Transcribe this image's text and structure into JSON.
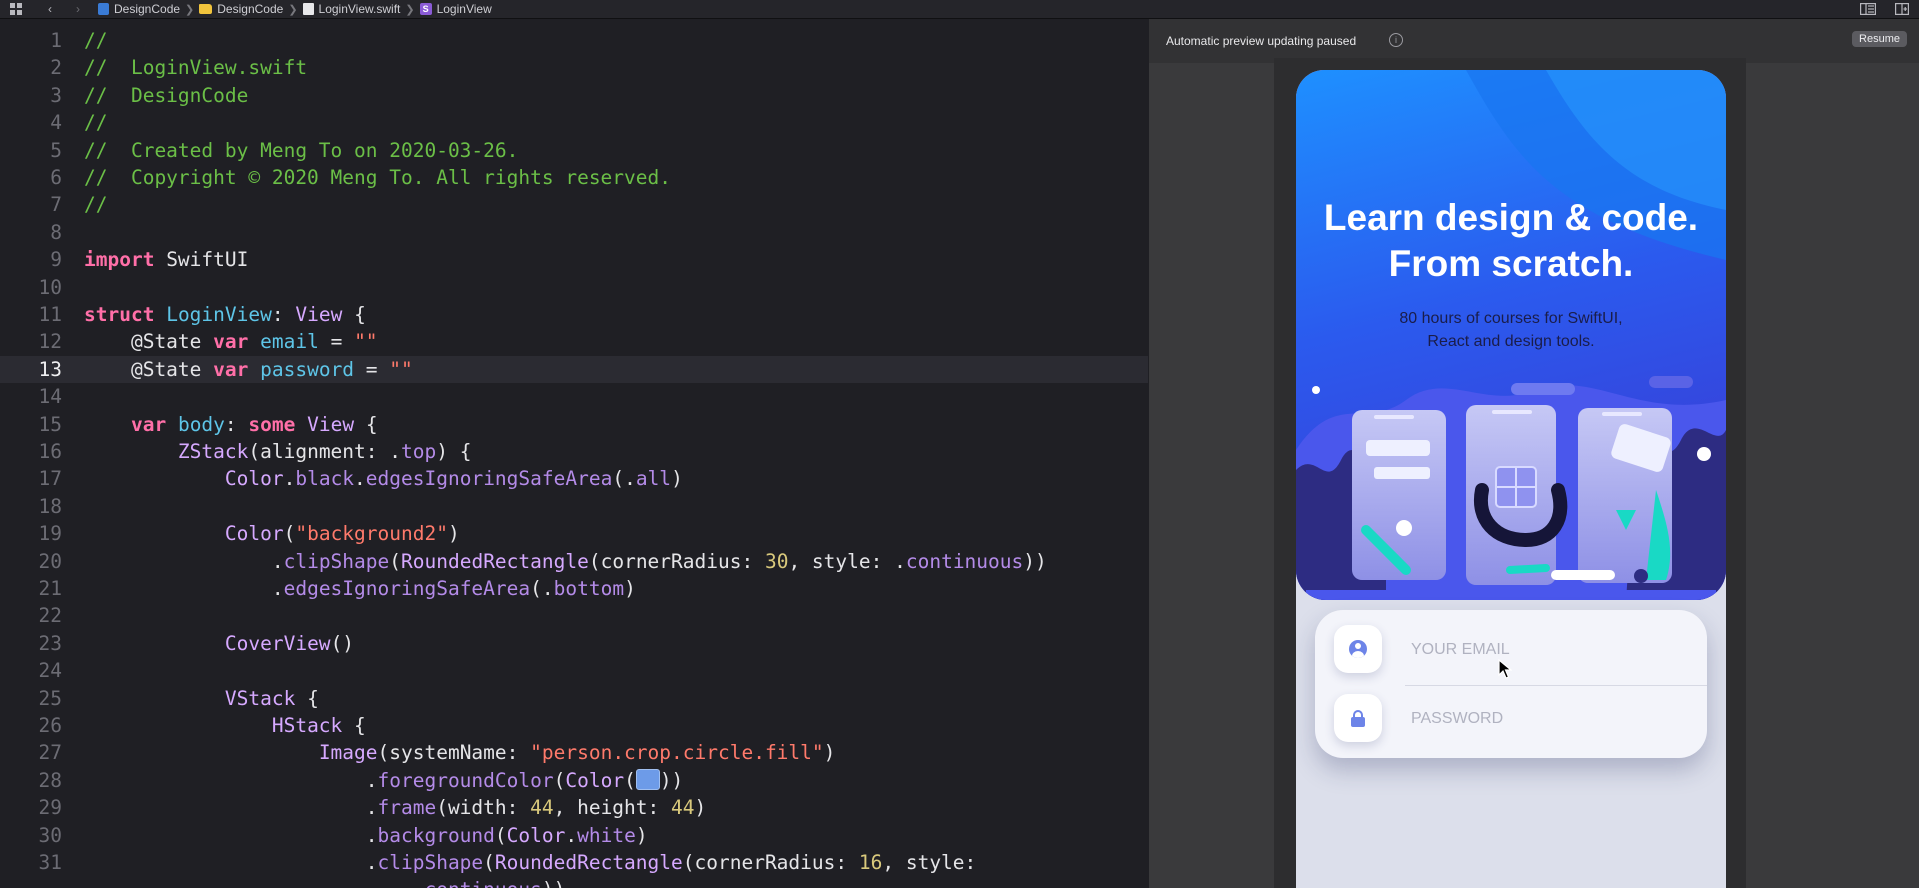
{
  "breadcrumb": {
    "items": [
      "DesignCode",
      "DesignCode",
      "LoginView.swift",
      "LoginView"
    ]
  },
  "editor": {
    "active_line": 13,
    "lines": [
      {
        "n": "1",
        "tokens": [
          [
            "c",
            "//"
          ]
        ]
      },
      {
        "n": "2",
        "tokens": [
          [
            "c",
            "//  LoginView.swift"
          ]
        ]
      },
      {
        "n": "3",
        "tokens": [
          [
            "c",
            "//  DesignCode"
          ]
        ]
      },
      {
        "n": "4",
        "tokens": [
          [
            "c",
            "//"
          ]
        ]
      },
      {
        "n": "5",
        "tokens": [
          [
            "c",
            "//  Created by Meng To on 2020-03-26."
          ]
        ]
      },
      {
        "n": "6",
        "tokens": [
          [
            "c",
            "//  Copyright © 2020 Meng To. All rights reserved."
          ]
        ]
      },
      {
        "n": "7",
        "tokens": [
          [
            "c",
            "//"
          ]
        ]
      },
      {
        "n": "8",
        "tokens": []
      },
      {
        "n": "9",
        "tokens": [
          [
            "k",
            "import"
          ],
          [
            "p",
            " SwiftUI"
          ]
        ]
      },
      {
        "n": "10",
        "tokens": []
      },
      {
        "n": "11",
        "tokens": [
          [
            "k",
            "struct"
          ],
          [
            "p",
            " "
          ],
          [
            "tn",
            "LoginView"
          ],
          [
            "p",
            ": "
          ],
          [
            "t",
            "View"
          ],
          [
            "p",
            " {"
          ]
        ]
      },
      {
        "n": "12",
        "tokens": [
          [
            "p",
            "    @State "
          ],
          [
            "k",
            "var"
          ],
          [
            "p",
            " "
          ],
          [
            "tn",
            "email"
          ],
          [
            "p",
            " = "
          ],
          [
            "s",
            "\"\""
          ]
        ]
      },
      {
        "n": "13",
        "tokens": [
          [
            "p",
            "    @State "
          ],
          [
            "k",
            "var"
          ],
          [
            "p",
            " "
          ],
          [
            "tn",
            "password"
          ],
          [
            "p",
            " = "
          ],
          [
            "s",
            "\"\""
          ]
        ]
      },
      {
        "n": "14",
        "tokens": []
      },
      {
        "n": "15",
        "tokens": [
          [
            "p",
            "    "
          ],
          [
            "k",
            "var"
          ],
          [
            "p",
            " "
          ],
          [
            "tn",
            "body"
          ],
          [
            "p",
            ": "
          ],
          [
            "k",
            "some"
          ],
          [
            "p",
            " "
          ],
          [
            "t",
            "View"
          ],
          [
            "p",
            " {"
          ]
        ]
      },
      {
        "n": "16",
        "tokens": [
          [
            "p",
            "        "
          ],
          [
            "t",
            "ZStack"
          ],
          [
            "p",
            "(alignment: ."
          ],
          [
            "m",
            "top"
          ],
          [
            "p",
            ") {"
          ]
        ]
      },
      {
        "n": "17",
        "tokens": [
          [
            "p",
            "            "
          ],
          [
            "t",
            "Color"
          ],
          [
            "p",
            "."
          ],
          [
            "m",
            "black"
          ],
          [
            "p",
            "."
          ],
          [
            "m",
            "edgesIgnoringSafeArea"
          ],
          [
            "p",
            "(."
          ],
          [
            "m",
            "all"
          ],
          [
            "p",
            ")"
          ]
        ]
      },
      {
        "n": "18",
        "tokens": []
      },
      {
        "n": "19",
        "tokens": [
          [
            "p",
            "            "
          ],
          [
            "t",
            "Color"
          ],
          [
            "p",
            "("
          ],
          [
            "s",
            "\"background2\""
          ],
          [
            "p",
            ")"
          ]
        ]
      },
      {
        "n": "20",
        "tokens": [
          [
            "p",
            "                ."
          ],
          [
            "m",
            "clipShape"
          ],
          [
            "p",
            "("
          ],
          [
            "t",
            "RoundedRectangle"
          ],
          [
            "p",
            "(cornerRadius: "
          ],
          [
            "n",
            "30"
          ],
          [
            "p",
            ", style: ."
          ],
          [
            "m",
            "continuous"
          ],
          [
            "p",
            "))"
          ]
        ]
      },
      {
        "n": "21",
        "tokens": [
          [
            "p",
            "                ."
          ],
          [
            "m",
            "edgesIgnoringSafeArea"
          ],
          [
            "p",
            "(."
          ],
          [
            "m",
            "bottom"
          ],
          [
            "p",
            ")"
          ]
        ]
      },
      {
        "n": "22",
        "tokens": []
      },
      {
        "n": "23",
        "tokens": [
          [
            "p",
            "            "
          ],
          [
            "t",
            "CoverView"
          ],
          [
            "p",
            "()"
          ]
        ]
      },
      {
        "n": "24",
        "tokens": []
      },
      {
        "n": "25",
        "tokens": [
          [
            "p",
            "            "
          ],
          [
            "t",
            "VStack"
          ],
          [
            "p",
            " {"
          ]
        ]
      },
      {
        "n": "26",
        "tokens": [
          [
            "p",
            "                "
          ],
          [
            "t",
            "HStack"
          ],
          [
            "p",
            " {"
          ]
        ]
      },
      {
        "n": "27",
        "tokens": [
          [
            "p",
            "                    "
          ],
          [
            "t",
            "Image"
          ],
          [
            "p",
            "(systemName: "
          ],
          [
            "s",
            "\"person.crop.circle.fill\""
          ],
          [
            "p",
            ")"
          ]
        ]
      },
      {
        "n": "28",
        "tokens": [
          [
            "p",
            "                        ."
          ],
          [
            "m",
            "foregroundColor"
          ],
          [
            "p",
            "("
          ],
          [
            "t",
            "Color"
          ],
          [
            "p",
            "("
          ],
          [
            "sw",
            ""
          ],
          [
            "p",
            "))"
          ]
        ]
      },
      {
        "n": "29",
        "tokens": [
          [
            "p",
            "                        ."
          ],
          [
            "m",
            "frame"
          ],
          [
            "p",
            "(width: "
          ],
          [
            "n",
            "44"
          ],
          [
            "p",
            ", height: "
          ],
          [
            "n",
            "44"
          ],
          [
            "p",
            ")"
          ]
        ]
      },
      {
        "n": "30",
        "tokens": [
          [
            "p",
            "                        ."
          ],
          [
            "m",
            "background"
          ],
          [
            "p",
            "("
          ],
          [
            "t",
            "Color"
          ],
          [
            "p",
            "."
          ],
          [
            "m",
            "white"
          ],
          [
            "p",
            ")"
          ]
        ]
      },
      {
        "n": "31",
        "tokens": [
          [
            "p",
            "                        ."
          ],
          [
            "m",
            "clipShape"
          ],
          [
            "p",
            "("
          ],
          [
            "t",
            "RoundedRectangle"
          ],
          [
            "p",
            "(cornerRadius: "
          ],
          [
            "n",
            "16"
          ],
          [
            "p",
            ", style:"
          ]
        ]
      },
      {
        "n": "",
        "tokens": [
          [
            "p",
            "                            ."
          ],
          [
            "m",
            "continuous"
          ],
          [
            "p",
            "))"
          ]
        ]
      }
    ]
  },
  "preview": {
    "status_text": "Automatic preview updating paused",
    "resume_label": "Resume",
    "hero_title_line1": "Learn design & code.",
    "hero_title_line2": "From scratch.",
    "hero_sub_line1": "80 hours of courses for SwiftUI,",
    "hero_sub_line2": "React and design tools.",
    "email_placeholder": "YOUR EMAIL",
    "password_placeholder": "PASSWORD"
  },
  "colors": {
    "hero_blue": "#2b4ae8",
    "accent": "#6d84e8",
    "comment": "#6bbf47",
    "keyword": "#ff6fa8"
  },
  "icons": {
    "top_left": "grid-icon",
    "back": "chevron-left-icon",
    "forward": "chevron-right-icon",
    "email_field": "person-crop-circle-fill-icon",
    "password_field": "lock-icon"
  }
}
